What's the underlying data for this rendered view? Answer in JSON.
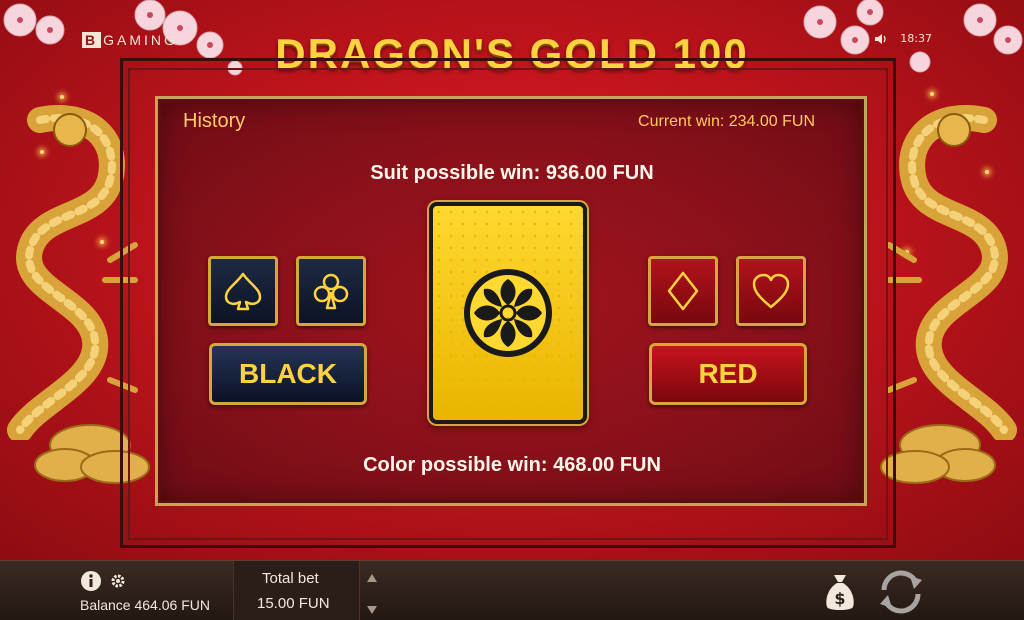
{
  "brand": {
    "prefix": "B",
    "rest": "GAMING"
  },
  "title": "DRAGON'S GOLD 100",
  "status": {
    "time": "18:37",
    "sound_icon": "speaker-icon"
  },
  "panel": {
    "history_label": "History",
    "current_win": "Current win: 234.00 FUN",
    "suit_possible_win": "Suit possible win: 936.00 FUN",
    "color_possible_win": "Color possible win: 468.00 FUN"
  },
  "suits": [
    {
      "name": "spade",
      "icon": "spade-icon"
    },
    {
      "name": "club",
      "icon": "club-icon"
    },
    {
      "name": "diamond",
      "icon": "diamond-icon"
    },
    {
      "name": "heart",
      "icon": "heart-icon"
    }
  ],
  "buttons": {
    "black": "BLACK",
    "red": "RED"
  },
  "bottom_bar": {
    "balance": "Balance 464.06 FUN",
    "total_bet_label": "Total bet",
    "total_bet_value": "15.00 FUN"
  },
  "colors": {
    "gold": "#ffd23f",
    "panel_red": "#86101a",
    "navy": "#0c1324"
  }
}
